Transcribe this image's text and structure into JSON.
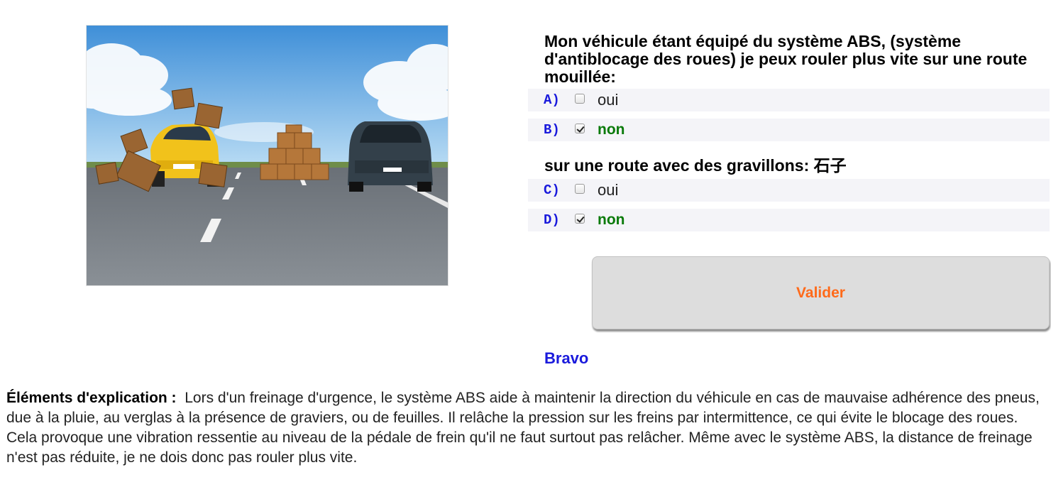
{
  "image": {
    "subject": "road-scene-cars-boxes"
  },
  "question1": {
    "title": "Mon véhicule étant équipé du système ABS, (système d'antiblocage des roues) je peux rouler plus vite sur une route mouillée:",
    "answers": [
      {
        "letter": "A)",
        "label": "oui",
        "checked": false
      },
      {
        "letter": "B)",
        "label": "non",
        "checked": true
      }
    ]
  },
  "question2": {
    "title": "sur une route avec des gravillons: 石子",
    "answers": [
      {
        "letter": "C)",
        "label": "oui",
        "checked": false
      },
      {
        "letter": "D)",
        "label": "non",
        "checked": true
      }
    ]
  },
  "validate_label": "Valider",
  "feedback": "Bravo",
  "explanation": {
    "heading": "Éléments d'explication :",
    "text": "Lors d'un freinage d'urgence, le système ABS aide à maintenir la direction du véhicule en cas de mauvaise adhérence des pneus, due à la pluie, au verglas à la présence de graviers, ou de feuilles. Il relâche la pression sur les freins par intermittence, ce qui évite le blocage des roues. Cela provoque une vibration ressentie au niveau de la pédale de frein qu'il ne faut surtout pas relâcher. Même avec le système ABS, la distance de freinage n'est pas réduite, je ne dois donc pas rouler plus vite."
  },
  "colors": {
    "letter": "#1a1adc",
    "correct": "#0a7a0a",
    "button_text": "#ff6a1a",
    "feedback": "#1a1adc"
  }
}
